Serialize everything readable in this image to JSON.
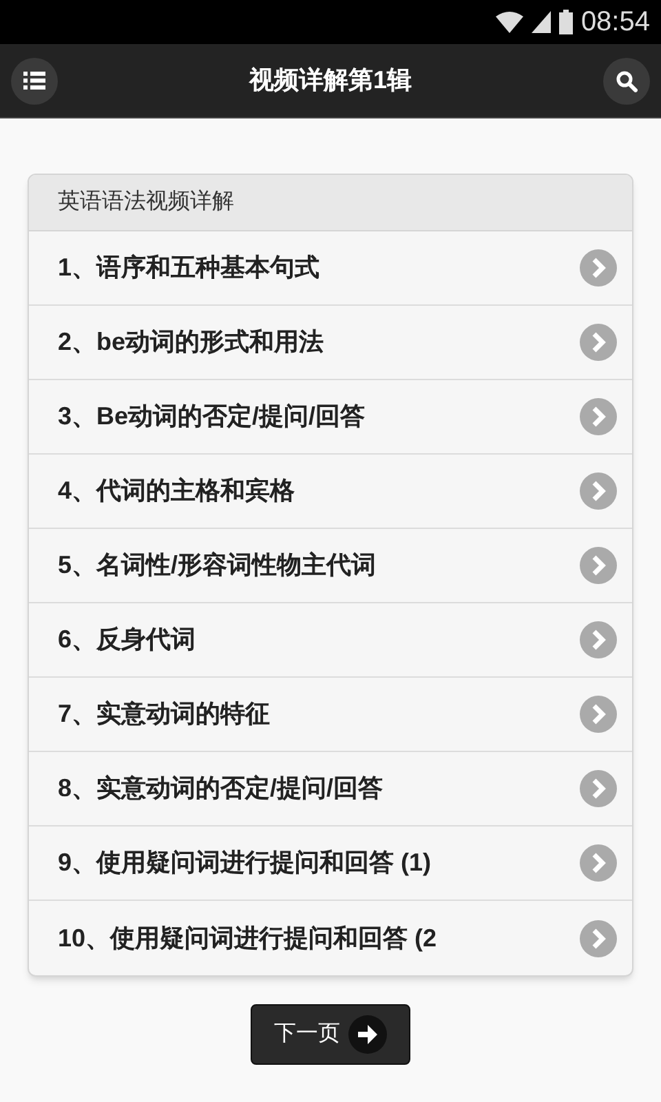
{
  "status_bar": {
    "time": "08:54"
  },
  "header": {
    "title": "视频详解第1辑"
  },
  "list": {
    "title": "英语语法视频详解",
    "items": [
      {
        "label": "1、语序和五种基本句式"
      },
      {
        "label": "2、be动词的形式和用法"
      },
      {
        "label": "3、Be动词的否定/提问/回答"
      },
      {
        "label": "4、代词的主格和宾格"
      },
      {
        "label": "5、名词性/形容词性物主代词"
      },
      {
        "label": "6、反身代词"
      },
      {
        "label": "7、实意动词的特征"
      },
      {
        "label": "8、实意动词的否定/提问/回答"
      },
      {
        "label": "9、使用疑问词进行提问和回答 (1)"
      },
      {
        "label": "10、使用疑问词进行提问和回答 (2"
      }
    ]
  },
  "next_button": {
    "label": "下一页"
  }
}
